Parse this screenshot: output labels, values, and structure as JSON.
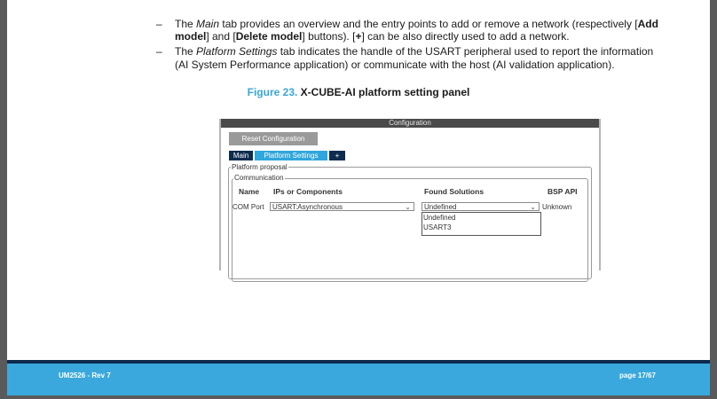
{
  "bullets": {
    "dash": "–",
    "b1": {
      "a": "The ",
      "main": "Main",
      "b": " tab provides an overview and the entry points to add or remove a network (respectively [",
      "add": "Add",
      "line2a": "model",
      "line2b": "] and [",
      "delete": "Delete model",
      "line2c": "] buttons). [",
      "plus": "+",
      "line2d": "] can be also directly used to add a network."
    },
    "b2": {
      "a": "The ",
      "platform": "Platform Settings",
      "b": " tab indicates the handle of the USART peripheral used to report the information",
      "line2": "(AI System Performance application) or communicate with the host (AI validation application)."
    }
  },
  "figure": {
    "number": "Figure 23.",
    "title": " X-CUBE-AI platform setting panel"
  },
  "panel": {
    "title": "Configuration",
    "reset_label": "Reset Configuration",
    "tabs": [
      "Main",
      "Platform Settings",
      "+"
    ],
    "group_outer": "Platform proposal",
    "group_inner": "Communication",
    "headers": [
      "Name",
      "IPs or Components",
      "Found Solutions",
      "BSP API"
    ],
    "row": {
      "name": "COM Port",
      "ip": "USART:Asynchronous",
      "found": "Undefined",
      "bsp": "Unknown"
    },
    "dropdown_options": [
      "Undefined",
      "USART3"
    ]
  },
  "footer": {
    "left": "UM2526 - Rev 7",
    "right": "page 17/67"
  },
  "colors": {
    "accent": "#3aa8dc",
    "dark_blue": "#0b2a4c"
  }
}
